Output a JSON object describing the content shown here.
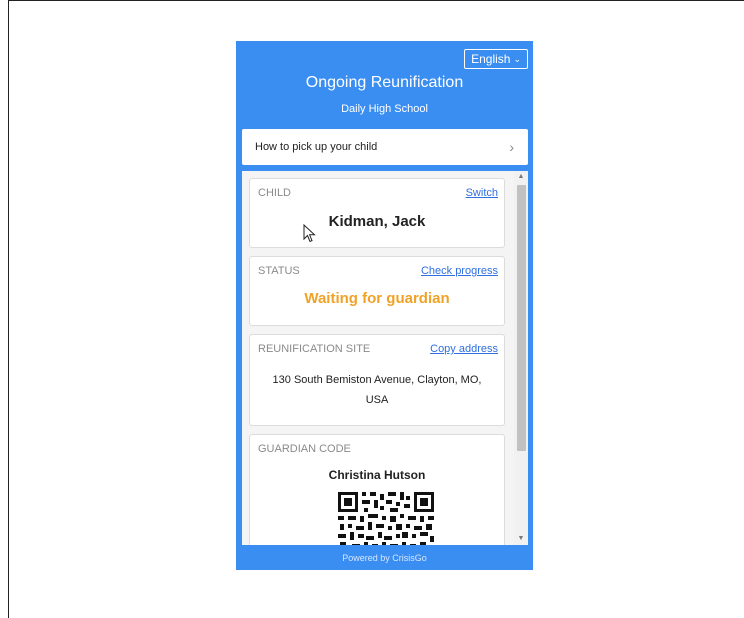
{
  "header": {
    "language": "English",
    "title": "Ongoing Reunification",
    "subtitle": "Daily High School"
  },
  "howto": {
    "label": "How to pick up your child",
    "icon": "chevron-right-icon"
  },
  "child": {
    "label": "CHILD",
    "link": "Switch",
    "name": "Kidman, Jack"
  },
  "status": {
    "label": "STATUS",
    "link": "Check progress",
    "value": "Waiting for guardian",
    "color": "#f0a228"
  },
  "site": {
    "label": "REUNIFICATION SITE",
    "link": "Copy address",
    "address": "130 South Bemiston Avenue, Clayton, MO, USA"
  },
  "guardian_code": {
    "label": "GUARDIAN CODE",
    "name": "Christina Hutson"
  },
  "footer": {
    "text": "Powered by CrisisGo"
  },
  "colors": {
    "brand": "#3a8ef2",
    "link": "#2f6fe0",
    "status": "#f0a228"
  }
}
